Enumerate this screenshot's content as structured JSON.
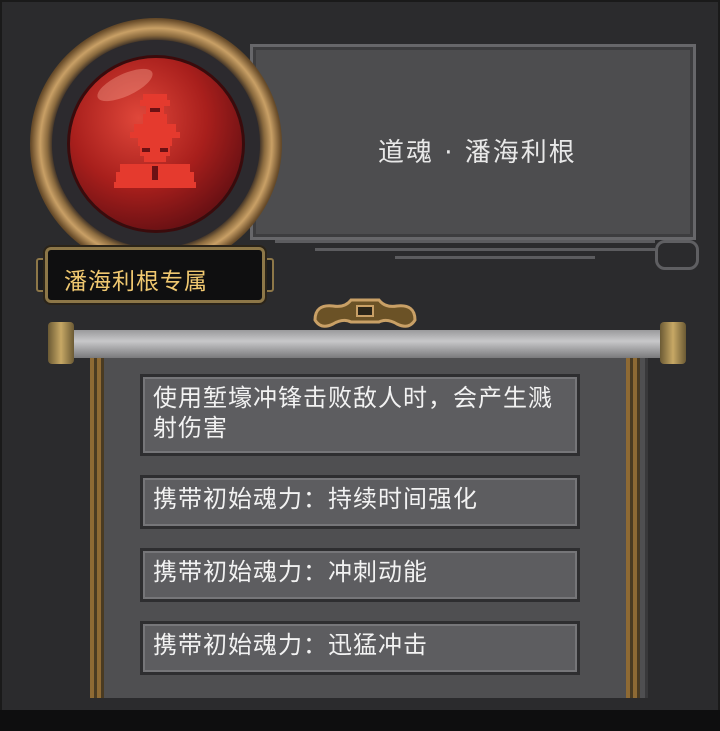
{
  "item": {
    "title": "道魂 · 潘海利根",
    "exclusive_label": "潘海利根专属",
    "icon": "soldier-portrait-icon"
  },
  "effects": [
    "使用堑壕冲锋击败敌人时，会产生溅射伤害",
    "携带初始魂力：持续时间强化",
    "携带初始魂力：冲刺动能",
    "携带初始魂力：迅猛冲击"
  ],
  "colors": {
    "panel": "#2b2b2d",
    "plaque": "#4d4d4f",
    "orb_red": "#a81f1c",
    "gold_text": "#f0c870",
    "gold_frame": "#8d7748",
    "effect_box": "#5d5d60"
  }
}
